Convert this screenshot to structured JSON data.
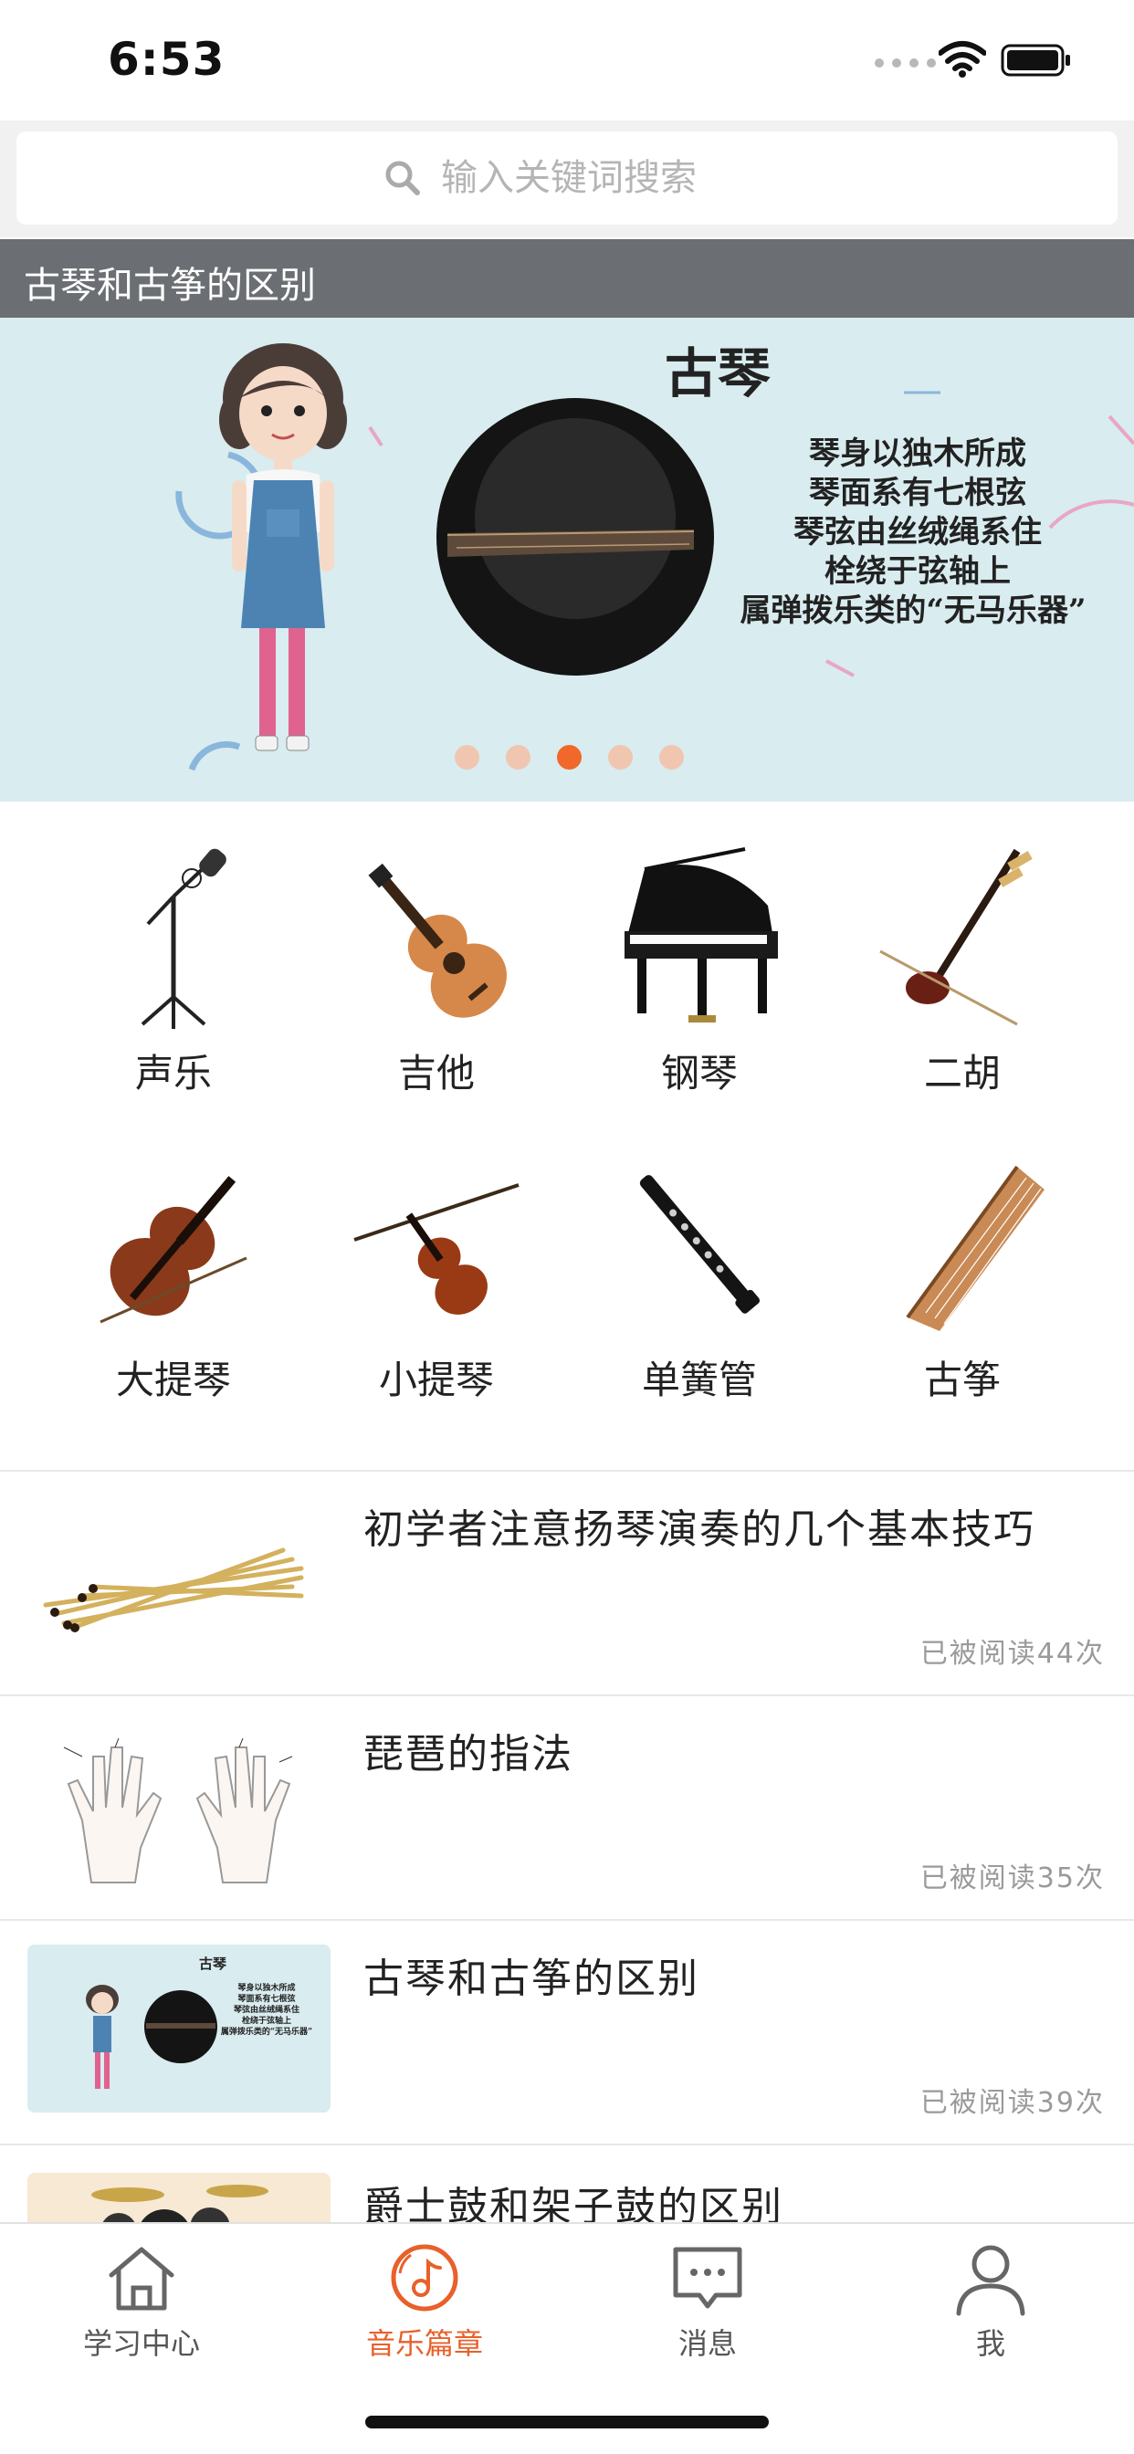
{
  "status_bar": {
    "time": "6:53"
  },
  "search": {
    "placeholder": "输入关键词搜索"
  },
  "banner": {
    "title": "古琴和古筝的区别",
    "heading": "古琴",
    "lines": [
      "琴身以独木所成",
      "琴面系有七根弦",
      "琴弦由丝绒绳系住",
      "栓绕于弦轴上",
      "属弹拨乐类的“无马乐器”"
    ],
    "pages": 5,
    "active_page": 3
  },
  "instruments": [
    {
      "label": "声乐",
      "icon": "microphone-stand-icon"
    },
    {
      "label": "吉他",
      "icon": "guitar-icon"
    },
    {
      "label": "钢琴",
      "icon": "grand-piano-icon"
    },
    {
      "label": "二胡",
      "icon": "erhu-icon"
    },
    {
      "label": "大提琴",
      "icon": "cello-icon"
    },
    {
      "label": "小提琴",
      "icon": "violin-icon"
    },
    {
      "label": "单簧管",
      "icon": "clarinet-icon"
    },
    {
      "label": "古筝",
      "icon": "guzheng-icon"
    }
  ],
  "articles": [
    {
      "title": "初学者注意扬琴演奏的几个基本技巧",
      "reads": "已被阅读44次",
      "thumb": "yangqin-hammers-thumbnail"
    },
    {
      "title": "琵琶的指法",
      "reads": "已被阅读35次",
      "thumb": "pipa-fingering-hands-thumbnail"
    },
    {
      "title": "古琴和古筝的区别",
      "reads": "已被阅读39次",
      "thumb": "guqin-banner-thumbnail"
    },
    {
      "title": "爵士鼓和架子鼓的区别",
      "reads": "",
      "thumb": "drum-kit-thumbnail"
    }
  ],
  "thumb_text": {
    "heading": "古琴",
    "lines": [
      "琴身以独木所成",
      "琴面系有七根弦",
      "琴弦由丝绒绳系住",
      "栓绕于弦轴上",
      "属弹拨乐类的“无马乐器”"
    ]
  },
  "tabbar": {
    "tabs": [
      {
        "label": "学习中心",
        "icon": "home-icon"
      },
      {
        "label": "音乐篇章",
        "icon": "music-disc-icon",
        "active": true
      },
      {
        "label": "消息",
        "icon": "message-icon"
      },
      {
        "label": "我",
        "icon": "profile-icon"
      }
    ]
  },
  "colors": {
    "accent": "#e8602a",
    "banner_bg": "#d9ecef",
    "title_bar": "#6b6e72"
  }
}
